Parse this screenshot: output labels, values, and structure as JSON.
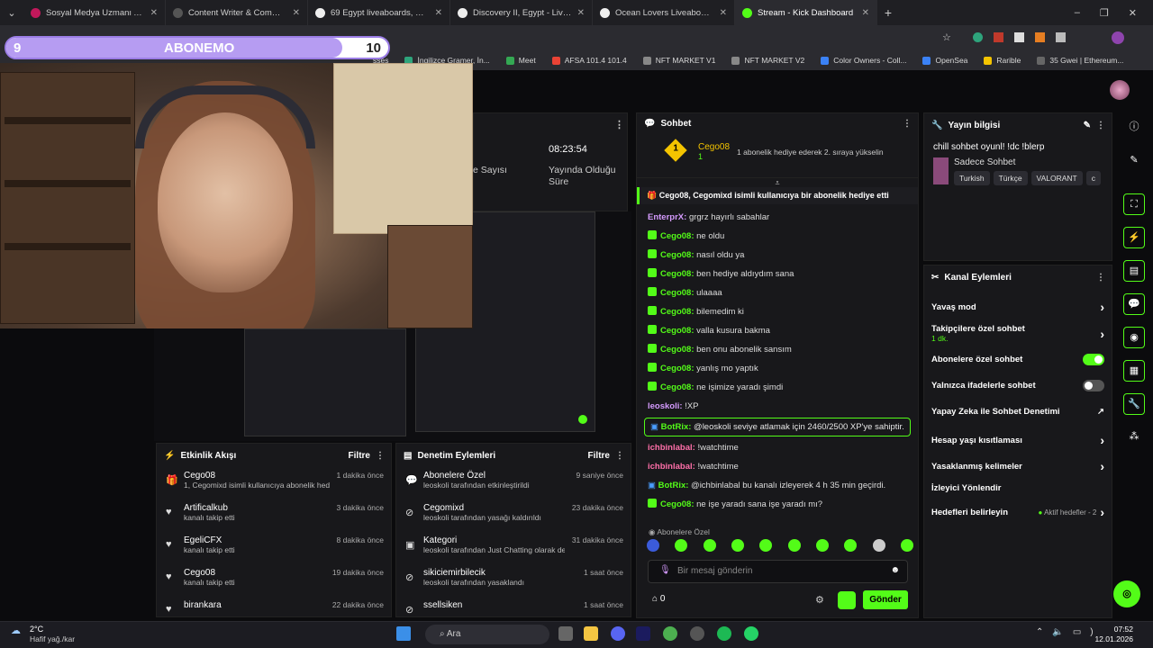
{
  "browser": {
    "tabs": [
      {
        "title": "Sosyal Medya Uzmanı Aranıyor",
        "color": "#c2185b"
      },
      {
        "title": "Content Writer & Community M",
        "color": "#555555"
      },
      {
        "title": "69 Egypt liveaboards, May 2026",
        "color": "#eeeeee"
      },
      {
        "title": "Discovery II, Egypt - LiveAboard",
        "color": "#eeeeee"
      },
      {
        "title": "Ocean Lovers Liveaboard, Egypt",
        "color": "#eeeeee"
      },
      {
        "title": "Stream - Kick Dashboard",
        "color": "#53fc18"
      }
    ],
    "bookmarks": [
      "İngilizce Gramer, İn...",
      "Meet",
      "AFSA 101.4 101.4",
      "NFT MARKET V1",
      "NFT MARKET V2",
      "Color Owners - Coll...",
      "OpenSea",
      "Rarible",
      "35 Gwei | Ethereum..."
    ],
    "bookmark_partial": "sses"
  },
  "overlay": {
    "left_num": "9",
    "label": "ABONEMO",
    "right_num": "10",
    "progress": 0.88
  },
  "stats": {
    "time": "08:23:54",
    "label_left": "e Sayısı",
    "label_right": "Yayında Olduğu Süre"
  },
  "activity": {
    "title": "Etkinlik Akışı",
    "filter": "Filtre",
    "rows": [
      {
        "name": "Cego08",
        "desc": "1, Cegomixd isimli kullanıcıya abonelik hediye etti.",
        "time": "1 dakika önce",
        "icon": "gift"
      },
      {
        "name": "Artificalkub",
        "desc": "kanalı takip etti",
        "time": "3 dakika önce",
        "icon": "heart"
      },
      {
        "name": "EgeliCFX",
        "desc": "kanalı takip etti",
        "time": "8 dakika önce",
        "icon": "heart"
      },
      {
        "name": "Cego08",
        "desc": "kanalı takip etti",
        "time": "19 dakika önce",
        "icon": "heart"
      },
      {
        "name": "birankara",
        "desc": "",
        "time": "22 dakika önce",
        "icon": "heart"
      }
    ]
  },
  "moderation": {
    "title": "Denetim Eylemleri",
    "filter": "Filtre",
    "rows": [
      {
        "name": "Abonelere Özel",
        "desc": "leoskoli tarafından etkinleştirildi",
        "time": "9 saniye önce"
      },
      {
        "name": "Cegomixd",
        "desc": "leoskoli tarafından yasağı kaldırıldı",
        "time": "23 dakika önce"
      },
      {
        "name": "Kategori",
        "desc": "leoskoli tarafından Just Chatting olarak değiştirildi",
        "time": "31 dakika önce"
      },
      {
        "name": "sikiciemirbilecik",
        "desc": "leoskoli tarafından yasaklandı",
        "time": "1 saat önce"
      },
      {
        "name": "ssellsiken",
        "desc": "",
        "time": "1 saat önce"
      }
    ]
  },
  "chat": {
    "title": "Sohbet",
    "pinned_user": "Cego08",
    "pinned_count": "1",
    "pinned_text": "1 abonelik hediye ederek 2. sıraya yükselin",
    "gift_text": "Cego08, Cegomixd isimli kullanıcıya bir abonelik hediye etti",
    "messages": [
      {
        "user": "EnterprX:",
        "text": "grgrz hayırlı sabahlar",
        "color": "#d59bff",
        "badge": false
      },
      {
        "user": "Cego08:",
        "text": "ne oldu",
        "color": "#53fc18",
        "badge": true
      },
      {
        "user": "Cego08:",
        "text": "nasıl oldu ya",
        "color": "#53fc18",
        "badge": true
      },
      {
        "user": "Cego08:",
        "text": "ben hediye aldıydım sana",
        "color": "#53fc18",
        "badge": true
      },
      {
        "user": "Cego08:",
        "text": "ulaaaa",
        "color": "#53fc18",
        "badge": true
      },
      {
        "user": "Cego08:",
        "text": "bilemedim ki",
        "color": "#53fc18",
        "badge": true
      },
      {
        "user": "Cego08:",
        "text": "valla kusura bakma",
        "color": "#53fc18",
        "badge": true
      },
      {
        "user": "Cego08:",
        "text": "ben onu abonelik sansım",
        "color": "#53fc18",
        "badge": true
      },
      {
        "user": "Cego08:",
        "text": "yanlış mo yaptık",
        "color": "#53fc18",
        "badge": true
      },
      {
        "user": "Cego08:",
        "text": "ne işimize yaradı şimdi",
        "color": "#53fc18",
        "badge": true
      },
      {
        "user": "leoskoli:",
        "text": "!XP",
        "color": "#d59bff",
        "badge": false
      }
    ],
    "bot1_user": "BotRix:",
    "bot1_text": "@leoskoli seviye atlamak için 2460/2500 XP'ye sahiptir.",
    "messages2": [
      {
        "user": "ichbinlabal:",
        "text": "!watchtime",
        "color": "#ff6fa9",
        "badge": false
      },
      {
        "user": "ichbinlabal:",
        "text": "!watchtime",
        "color": "#ff6fa9",
        "badge": false
      }
    ],
    "bot2_user": "BotRix:",
    "bot2_text": "@ichbinlabal bu kanalı izleyerek 4 h 35 min geçirdi.",
    "last_user": "Cego08:",
    "last_text": "ne işe yaradı sana işe yaradı mı?",
    "mode_label": "Abonelere Özel",
    "input_placeholder": "Bir mesaj gönderin",
    "points": "0",
    "send": "Gönder"
  },
  "streaminfo": {
    "title": "Yayın bilgisi",
    "stream_title": "chill sohbet oyunl! !dc !blerp",
    "category": "Sadece Sohbet",
    "tags": [
      "Turkish",
      "Türkçe",
      "VALORANT",
      "c"
    ]
  },
  "channel": {
    "title": "Kanal Eylemleri",
    "slow": "Yavaş mod",
    "followers": "Takipçilere özel sohbet",
    "followers_sub": "1 dk.",
    "subs": "Abonelere özel sohbet",
    "emotes": "Yalnızca ifadelerle sohbet",
    "ai": "Yapay Zeka ile Sohbet Denetimi",
    "age": "Hesap yaşı kısıtlaması",
    "banned": "Yasaklanmış kelimeler",
    "redirect": "İzleyici Yönlendir",
    "goals": "Hedefleri belirleyin",
    "goals_sub": "Aktif hedefler - 2"
  },
  "taskbar": {
    "weather_temp": "2°C",
    "weather_desc": "Hafif yağ./kar",
    "search": "Ara",
    "time": "07:52",
    "date": "12.01.2026"
  }
}
